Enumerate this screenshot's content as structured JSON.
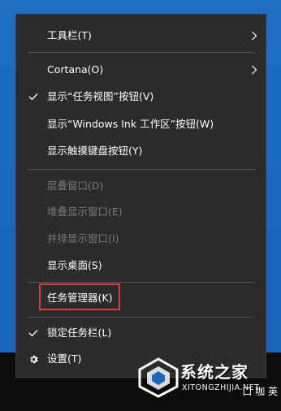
{
  "menu": {
    "items": [
      {
        "label": "工具栏(T)",
        "enabled": true,
        "checked": false,
        "submenu": true
      },
      {
        "label": "Cortana(O)",
        "enabled": true,
        "checked": false,
        "submenu": true
      },
      {
        "label": "显示“任务视图”按钮(V)",
        "enabled": true,
        "checked": true,
        "submenu": false
      },
      {
        "label": "显示“Windows Ink 工作区”按钮(W)",
        "enabled": true,
        "checked": false,
        "submenu": false
      },
      {
        "label": "显示触摸键盘按钮(Y)",
        "enabled": true,
        "checked": false,
        "submenu": false
      },
      {
        "label": "层叠窗口(D)",
        "enabled": false,
        "checked": false,
        "submenu": false
      },
      {
        "label": "堆叠显示窗口(E)",
        "enabled": false,
        "checked": false,
        "submenu": false
      },
      {
        "label": "并排显示窗口(I)",
        "enabled": false,
        "checked": false,
        "submenu": false
      },
      {
        "label": "显示桌面(S)",
        "enabled": true,
        "checked": false,
        "submenu": false
      },
      {
        "label": "任务管理器(K)",
        "enabled": true,
        "checked": false,
        "submenu": false,
        "highlighted": true
      },
      {
        "label": "锁定任务栏(L)",
        "enabled": true,
        "checked": true,
        "submenu": false
      },
      {
        "label": "设置(T)",
        "enabled": true,
        "checked": false,
        "submenu": false,
        "icon": "gear-icon"
      }
    ]
  },
  "watermark": {
    "title": "系统之家",
    "subtitle": "XITONGZHIJIA.NET"
  },
  "tray": {
    "text": "口 咖 英"
  },
  "colors": {
    "menu_bg": "#2b2b2b",
    "text": "#ffffff",
    "disabled_text": "#7a7a7a",
    "highlight_border": "#e03a3a",
    "desktop": "#1a66bd",
    "taskbar": "#0c0c0c"
  }
}
